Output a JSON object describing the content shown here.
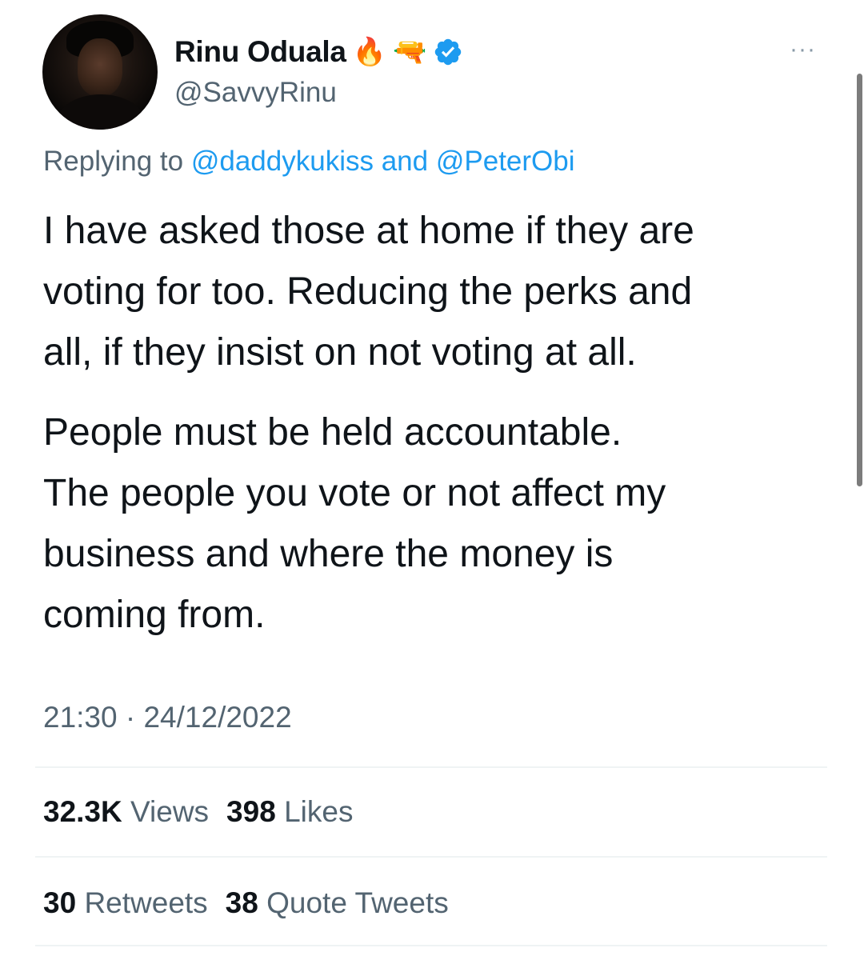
{
  "tweet": {
    "author_name": "Rinu Oduala",
    "author_emojis": [
      "🔥",
      "🔫"
    ],
    "handle": "@SavvyRinu",
    "more_label": "···",
    "reply_prefix": "Replying to",
    "reply_user_1": "@daddykukiss",
    "reply_and": "and",
    "reply_user_2": "@PeterObi",
    "paragraph_1": "I have asked those at home if they are\nvoting for too. Reducing the perks and\nall, if they insist on not voting at all.",
    "paragraph_2": "People must be held accountable.\nThe people you vote or not affect my\nbusiness and where the money is\ncoming from.",
    "time": "21:30",
    "separator": "·",
    "date": "24/12/2022"
  },
  "stats": {
    "views_count": "32.3K",
    "views_label": "Views",
    "likes_count": "398",
    "likes_label": "Likes",
    "retweets_count": "30",
    "retweets_label": "Retweets",
    "quotes_count": "38",
    "quotes_label": "Quote Tweets"
  },
  "colors": {
    "text": "#0f1419",
    "secondary": "#536471",
    "link": "#1d9bf0",
    "verified": "#1d9bf0",
    "divider": "#eff3f4"
  },
  "icons": {
    "verified": "verified-badge-icon",
    "more": "more-options-icon"
  }
}
